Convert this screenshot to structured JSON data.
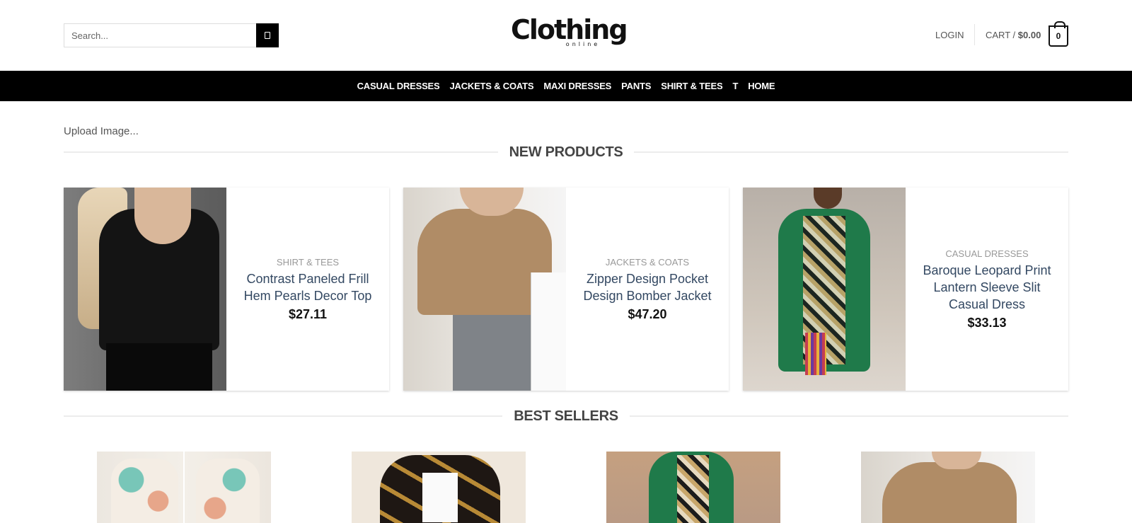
{
  "header": {
    "search_placeholder": "Search...",
    "logo_main": "Clothing",
    "logo_sub": "online",
    "login_label": "LOGIN",
    "cart_label": "CART /",
    "cart_total": "$0.00",
    "cart_count": "0"
  },
  "nav": {
    "items": [
      {
        "label": "CASUAL DRESSES"
      },
      {
        "label": "JACKETS & COATS"
      },
      {
        "label": "MAXI DRESSES"
      },
      {
        "label": "PANTS"
      },
      {
        "label": "SHIRT & TEES"
      },
      {
        "label": "T"
      },
      {
        "label": "HOME"
      }
    ]
  },
  "upload_label": "Upload Image...",
  "new_products": {
    "title": "NEW PRODUCTS",
    "items": [
      {
        "category": "SHIRT & TEES",
        "name": "Contrast Paneled Frill Hem Pearls Decor Top",
        "price": "$27.11"
      },
      {
        "category": "JACKETS & COATS",
        "name": "Zipper Design Pocket Design Bomber Jacket",
        "price": "$47.20"
      },
      {
        "category": "CASUAL DRESSES",
        "name": "Baroque Leopard Print Lantern Sleeve Slit Casual Dress",
        "price": "$33.13"
      }
    ]
  },
  "best_sellers": {
    "title": "BEST SELLERS"
  },
  "colors": {
    "nav_bg": "#000000",
    "title_link": "#334862",
    "category": "#999999"
  }
}
